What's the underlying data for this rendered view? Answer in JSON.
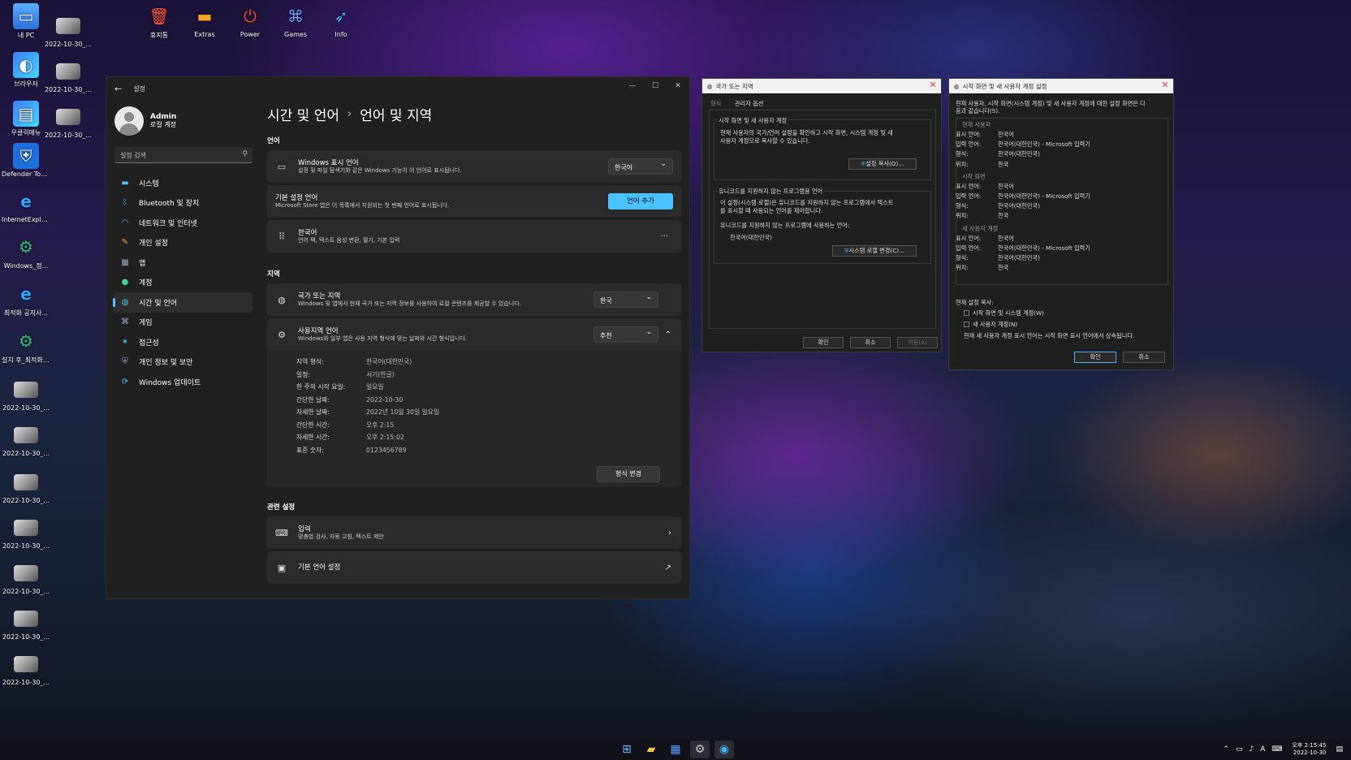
{
  "desktop": {
    "icons": [
      {
        "label": "내 PC",
        "icon": "computer-icon"
      },
      {
        "label": "2022-10-30_...",
        "icon": "image-file-icon"
      },
      {
        "label": "휴지통",
        "icon": "recycle-bin-icon"
      },
      {
        "label": "Extras",
        "icon": "folder-icon"
      },
      {
        "label": "Power",
        "icon": "power-icon"
      },
      {
        "label": "Games",
        "icon": "gamepad-icon"
      },
      {
        "label": "Info",
        "icon": "bird-icon"
      },
      {
        "label": "브라우저",
        "icon": "browser-icon"
      },
      {
        "label": "2022-10-30_...",
        "icon": "image-file-icon"
      },
      {
        "label": "우클릭메뉴",
        "icon": "menu-app-icon"
      },
      {
        "label": "2022-10-30_...",
        "icon": "image-file-icon"
      },
      {
        "label": "Defender Tools.exe",
        "icon": "shield-icon"
      },
      {
        "label": "InternetExplor...",
        "icon": "ie-icon"
      },
      {
        "label": "Windows_정...",
        "icon": "gear-icon"
      },
      {
        "label": "최적화 공지사...",
        "icon": "ie-icon"
      },
      {
        "label": "설치 후_최적화.cmd",
        "icon": "gear-icon"
      },
      {
        "label": "2022-10-30_...",
        "icon": "image-file-icon"
      },
      {
        "label": "2022-10-30_...",
        "icon": "image-file-icon"
      },
      {
        "label": "2022-10-30_...",
        "icon": "image-file-icon"
      },
      {
        "label": "2022-10-30_...",
        "icon": "image-file-icon"
      },
      {
        "label": "2022-10-30_...",
        "icon": "image-file-icon"
      },
      {
        "label": "2022-10-30_...",
        "icon": "image-file-icon"
      },
      {
        "label": "2022-10-30_...",
        "icon": "image-file-icon"
      }
    ]
  },
  "settings": {
    "window_title": "설정",
    "user": {
      "name": "Admin",
      "type": "로컬 계정"
    },
    "search_placeholder": "설정 검색",
    "nav": [
      {
        "label": "시스템",
        "icon": "monitor-icon"
      },
      {
        "label": "Bluetooth 및 장치",
        "icon": "bluetooth-icon"
      },
      {
        "label": "네트워크 및 인터넷",
        "icon": "wifi-icon"
      },
      {
        "label": "개인 설정",
        "icon": "brush-icon"
      },
      {
        "label": "앱",
        "icon": "apps-icon"
      },
      {
        "label": "계정",
        "icon": "person-icon"
      },
      {
        "label": "시간 및 언어",
        "icon": "globe-clock-icon"
      },
      {
        "label": "게임",
        "icon": "gamepad-icon"
      },
      {
        "label": "접근성",
        "icon": "accessibility-icon"
      },
      {
        "label": "개인 정보 및 보안",
        "icon": "shield-icon"
      },
      {
        "label": "Windows 업데이트",
        "icon": "update-icon"
      }
    ],
    "breadcrumb": {
      "parent": "시간 및 언어",
      "sep": "›",
      "current": "언어 및 지역"
    },
    "language_section": "언어",
    "display_lang": {
      "title": "Windows 표시 언어",
      "sub": "설정 및 파일 탐색기와 같은 Windows 기능이 이 언어로 표시됩니다.",
      "value": "한국어"
    },
    "preferred_lang": {
      "title": "기본 설정 언어",
      "sub": "Microsoft Store 앱은 이 목록에서 지원되는 첫 번째 언어로 표시됩니다.",
      "button": "언어 추가"
    },
    "korean": {
      "title": "한국어",
      "sub": "언어 팩, 텍스트 음성 변환, 필기, 기본 입력",
      "more": "···"
    },
    "region_section": "지역",
    "country": {
      "title": "국가 또는 지역",
      "sub": "Windows 및 앱에서 현재 국가 또는 지역 정보를 사용하여 로컬 콘텐츠를 제공할 수 있습니다.",
      "value": "한국"
    },
    "regional_format": {
      "title": "사용지역 언어",
      "sub": "Windows와 일부 앱은 사용 지역 형식에 맞는 날짜와 시간 형식입니다.",
      "value": "추천"
    },
    "format_rows": [
      {
        "k": "지역 형식:",
        "v": "한국어(대한민국)"
      },
      {
        "k": "일정:",
        "v": "서기(한글)"
      },
      {
        "k": "한 주의 시작 요일:",
        "v": "일요일"
      },
      {
        "k": "간단한 날짜:",
        "v": "2022-10-30"
      },
      {
        "k": "자세한 날짜:",
        "v": "2022년 10월 30일 일요일"
      },
      {
        "k": "간단한 시간:",
        "v": "오후 2:15"
      },
      {
        "k": "자세한 시간:",
        "v": "오후 2:15:02"
      },
      {
        "k": "표준 숫자:",
        "v": "0123456789"
      }
    ],
    "format_button": "형식 변경",
    "related_section": "관련 설정",
    "input": {
      "title": "입력",
      "sub": "맞춤법 검사, 자동 고침, 텍스트 제안"
    },
    "admin_lang": {
      "title": "기본 언어 설정"
    }
  },
  "region_dialog": {
    "title": "국가 또는 지역",
    "tabs": [
      "형식",
      "관리자 옵션"
    ],
    "g1_title": "시작 화면 및 새 사용자 계정",
    "g1_text1": "현재 사용자의 국가/언어 설정을 확인하고 시작 화면, 시스템 계정 및 새",
    "g1_text2": "사용자 계정으로 복사할 수 있습니다.",
    "copy_btn": "설정 복사(O)...",
    "g2_title": "유니코드를 지원하지 않는 프로그램용 언어",
    "g2_text1": "이 설정(시스템 로캘)은 유니코드를 지원하지 않는 프로그램에서 텍스트",
    "g2_text2": "를 표시할 때 사용되는 언어를 제어합니다.",
    "g2_text3": "유니코드를 지원하지 않는 프로그램에 사용하는 언어:",
    "g2_value": "한국어(대한민국)",
    "locale_btn": "시스템 로캘 변경(C)...",
    "ok": "확인",
    "cancel": "취소",
    "apply": "적용(A)"
  },
  "copy_dialog": {
    "title": "시작 화면 및 새 사용자 계정 설정",
    "intro1": "현재 사용자, 시작 화면(시스템 계정) 및 새 사용자 계정에 대한 설정 화면은 다",
    "intro2": "음과 같습니다(S).",
    "sections": [
      {
        "head": "현재 사용자",
        "rows": [
          [
            "표시 언어:",
            "한국어"
          ],
          [
            "입력 언어:",
            "한국어(대한민국) - Microsoft 입력기"
          ],
          [
            "형식:",
            "한국어(대한민국)"
          ],
          [
            "위치:",
            "한국"
          ]
        ]
      },
      {
        "head": "시작 화면",
        "rows": [
          [
            "표시 언어:",
            "한국어"
          ],
          [
            "입력 언어:",
            "한국어(대한민국) - Microsoft 입력기"
          ],
          [
            "형식:",
            "한국어(대한민국)"
          ],
          [
            "위치:",
            "한국"
          ]
        ]
      },
      {
        "head": "새 사용자 계정",
        "rows": [
          [
            "표시 언어:",
            "한국어"
          ],
          [
            "입력 언어:",
            "한국어(대한민국) - Microsoft 입력기"
          ],
          [
            "형식:",
            "한국어(대한민국)"
          ],
          [
            "위치:",
            "한국"
          ]
        ]
      }
    ],
    "copy_label": "현재 설정 복사:",
    "check1": "시작 화면 및 시스템 계정(W)",
    "check2": "새 사용자 계정(N)",
    "note": "현재 새 사용자 계정 표시 언어는 시작 화면 표시 언어에서 상속됩니다.",
    "ok": "확인",
    "cancel": "취소"
  },
  "taskbar": {
    "apps": [
      {
        "icon": "start-icon"
      },
      {
        "icon": "file-explorer-icon"
      },
      {
        "icon": "store-icon"
      },
      {
        "icon": "settings-icon"
      },
      {
        "icon": "browser-icon"
      }
    ],
    "time": "오후 2:15:45",
    "date": "2022-10-30",
    "ime": "A"
  }
}
